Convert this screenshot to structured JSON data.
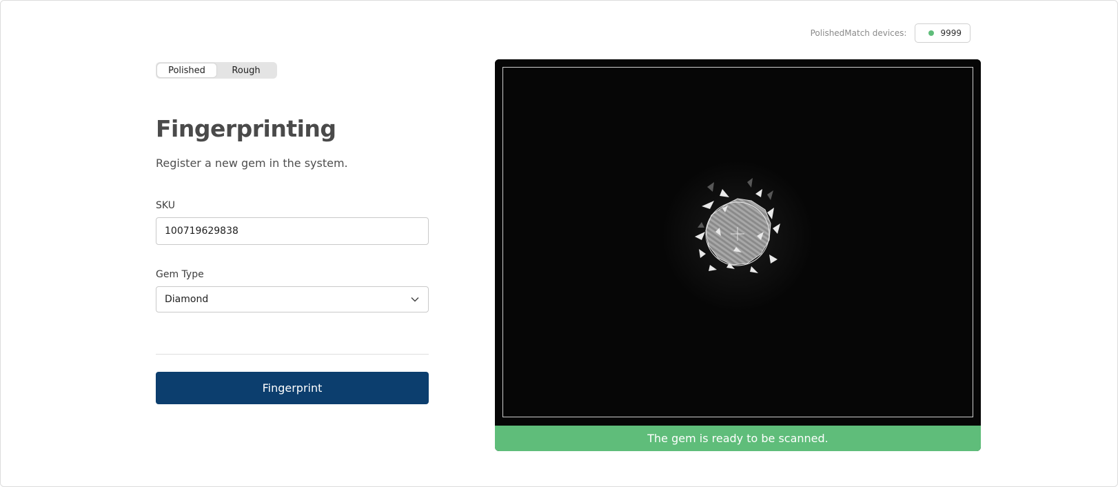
{
  "devices": {
    "label": "PolishedMatch devices:",
    "count": "9999",
    "status_color": "#5fbd7a"
  },
  "mode_toggle": {
    "options": [
      {
        "label": "Polished",
        "active": true
      },
      {
        "label": "Rough",
        "active": false
      }
    ]
  },
  "header": {
    "title": "Fingerprinting",
    "subtitle": "Register a new gem in the system."
  },
  "form": {
    "sku": {
      "label": "SKU",
      "value": "100719629838"
    },
    "gem_type": {
      "label": "Gem Type",
      "selected": "Diamond"
    },
    "submit_label": "Fingerprint"
  },
  "camera": {
    "status_text": "The gem is ready to be scanned.",
    "status_color": "#5fbd7a"
  },
  "colors": {
    "primary": "#0c3e6e",
    "success": "#5fbd7a"
  },
  "icons": {
    "select_arrow": "chevron-down-icon",
    "status": "status-dot-icon",
    "crosshair": "crosshair-icon"
  }
}
